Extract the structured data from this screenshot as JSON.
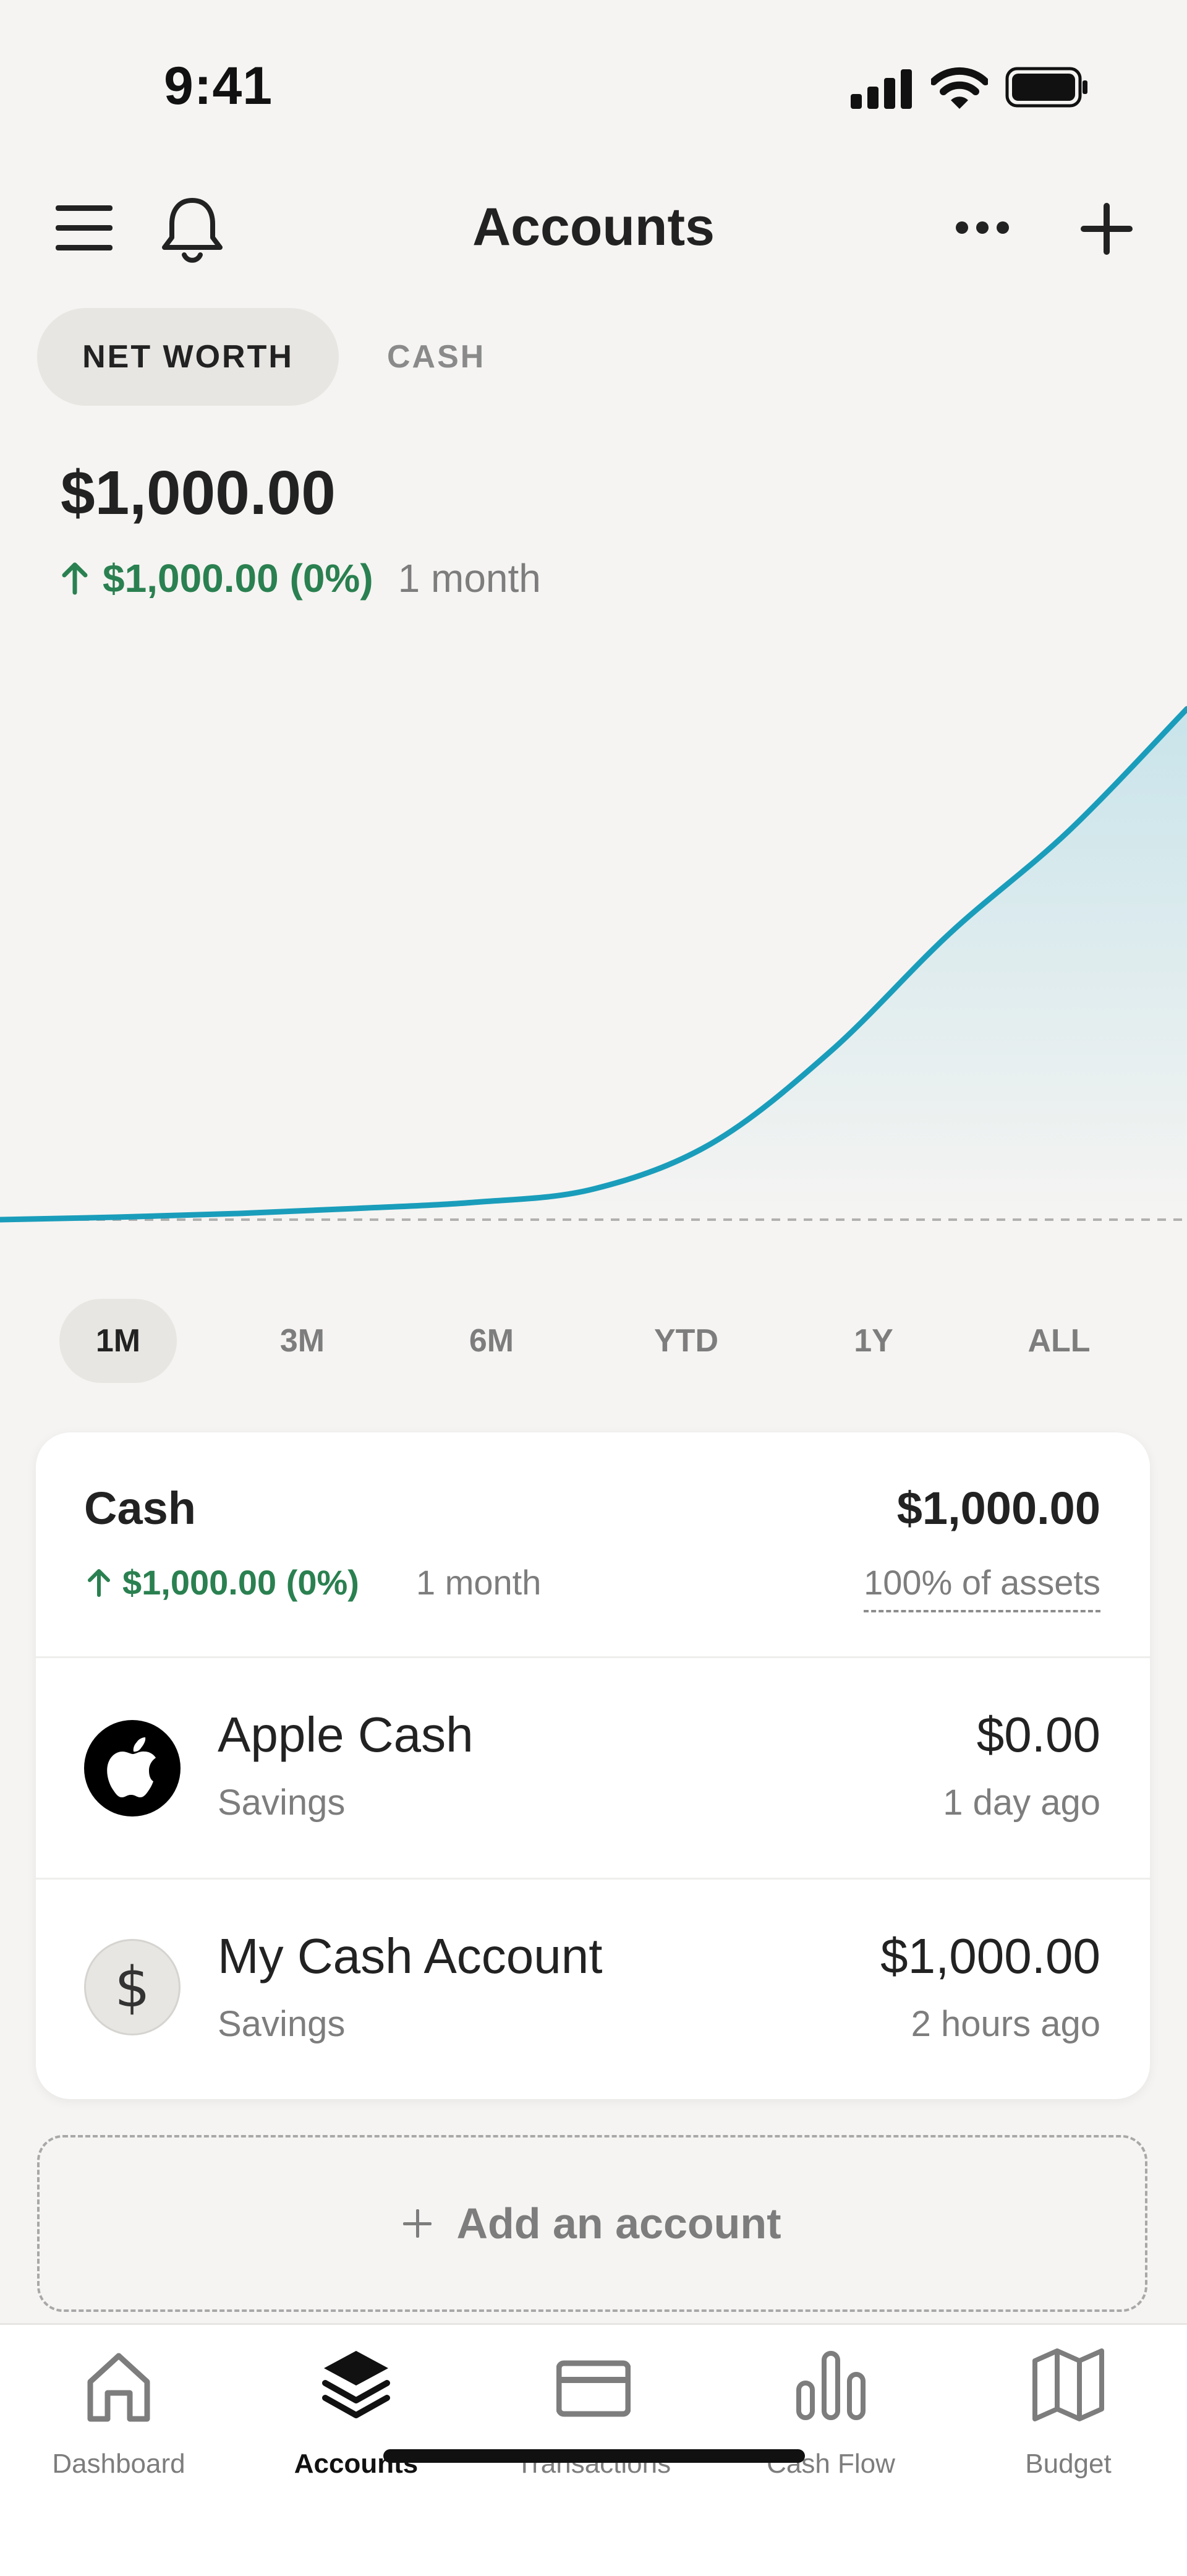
{
  "status_bar": {
    "time": "9:41"
  },
  "header": {
    "title": "Accounts",
    "icons": [
      "menu-icon",
      "bell-icon",
      "more-icon",
      "plus-icon"
    ]
  },
  "segments": {
    "net_worth": "NET WORTH",
    "cash": "CASH",
    "selected": "NET WORTH"
  },
  "summary": {
    "value": "$1,000.00",
    "change": "$1,000.00 (0%)",
    "period": "1 month"
  },
  "chart_data": {
    "type": "area",
    "title": "",
    "xlabel": "",
    "ylabel": "",
    "x": [
      0,
      0.1,
      0.2,
      0.3,
      0.4,
      0.5,
      0.6,
      0.7,
      0.8,
      0.9,
      1.0
    ],
    "values": [
      0,
      5,
      12,
      22,
      34,
      60,
      150,
      330,
      560,
      760,
      1000
    ],
    "baseline": 0,
    "ylim": [
      0,
      1000
    ],
    "line_color": "#1a9dbb",
    "fill_color": "#c6e3ea",
    "grid": false
  },
  "ranges": {
    "items": [
      "1M",
      "3M",
      "6M",
      "YTD",
      "1Y",
      "ALL"
    ],
    "selected": "1M"
  },
  "cash_group": {
    "name": "Cash",
    "value": "$1,000.00",
    "change": "$1,000.00 (0%)",
    "period": "1 month",
    "share": "100% of assets",
    "accounts": [
      {
        "name": "Apple Cash",
        "type": "Savings",
        "balance": "$0.00",
        "updated": "1 day ago",
        "icon": "apple-icon"
      },
      {
        "name": "My Cash Account",
        "type": "Savings",
        "balance": "$1,000.00",
        "updated": "2 hours ago",
        "icon": "dollar-icon"
      }
    ]
  },
  "add_account": {
    "label": "Add an account"
  },
  "tabbar": {
    "items": [
      {
        "label": "Dashboard",
        "icon": "home-icon"
      },
      {
        "label": "Accounts",
        "icon": "layers-icon"
      },
      {
        "label": "Transactions",
        "icon": "card-icon"
      },
      {
        "label": "Cash Flow",
        "icon": "bar-chart-icon"
      },
      {
        "label": "Budget",
        "icon": "map-icon"
      }
    ],
    "selected": "Accounts"
  },
  "colors": {
    "accent_green": "#2a8050",
    "chart_line": "#1a9dbb",
    "background": "#f5f4f2"
  }
}
